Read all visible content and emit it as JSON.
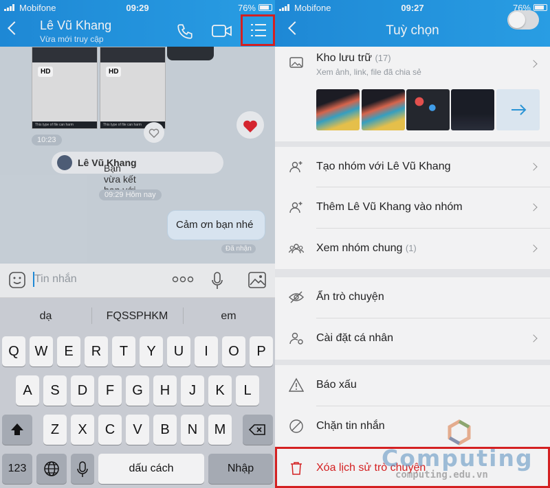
{
  "left": {
    "status": {
      "carrier": "Mobifone",
      "time": "09:29",
      "battery": "76%"
    },
    "header": {
      "name": "Lê Vũ Khang",
      "subtitle": "Vừa mới truy cập"
    },
    "chat": {
      "thumb_badge": "HD",
      "thumb_warning": "This type of file can harm",
      "time_1": "10:23",
      "friend_notice_prefix": "Bạn vừa kết bạn với ",
      "friend_notice_name": "Lê Vũ Khang",
      "time_2": "09:29 Hôm nay",
      "message": "Cảm ơn bạn nhé",
      "seen": "Đã nhận"
    },
    "input": {
      "placeholder": "Tin nhắn"
    },
    "keyboard": {
      "suggestions": [
        "dạ",
        "FQSSPHKM",
        "em"
      ],
      "row1": [
        "Q",
        "W",
        "E",
        "R",
        "T",
        "Y",
        "U",
        "I",
        "O",
        "P"
      ],
      "row2": [
        "A",
        "S",
        "D",
        "F",
        "G",
        "H",
        "J",
        "K",
        "L"
      ],
      "row3": [
        "Z",
        "X",
        "C",
        "V",
        "B",
        "N",
        "M"
      ],
      "numbers": "123",
      "space": "dấu cách",
      "enter": "Nhập"
    }
  },
  "right": {
    "status": {
      "carrier": "Mobifone",
      "time": "09:27",
      "battery": "76%"
    },
    "header": {
      "title": "Tuỳ chọn"
    },
    "storage": {
      "title": "Kho lưu trữ",
      "count": "(17)",
      "subtitle": "Xem ảnh, link, file đã chia sẻ"
    },
    "menu": {
      "create_group": "Tạo nhóm với Lê Vũ Khang",
      "add_to_group": "Thêm Lê Vũ Khang vào nhóm",
      "common_groups": "Xem nhóm chung",
      "common_groups_count": "(1)",
      "hide_chat": "Ẩn trò chuyện",
      "personal_settings": "Cài đặt cá nhân",
      "report": "Báo xấu",
      "block": "Chặn tin nhắn",
      "delete_history": "Xóa lịch sử trò chuyện"
    }
  },
  "watermark": {
    "brand": "Computing",
    "site": "computing.edu.vn"
  },
  "colors": {
    "brand_blue": "#1e8fe0",
    "danger_red": "#e02020",
    "highlight_red": "#e02020"
  }
}
